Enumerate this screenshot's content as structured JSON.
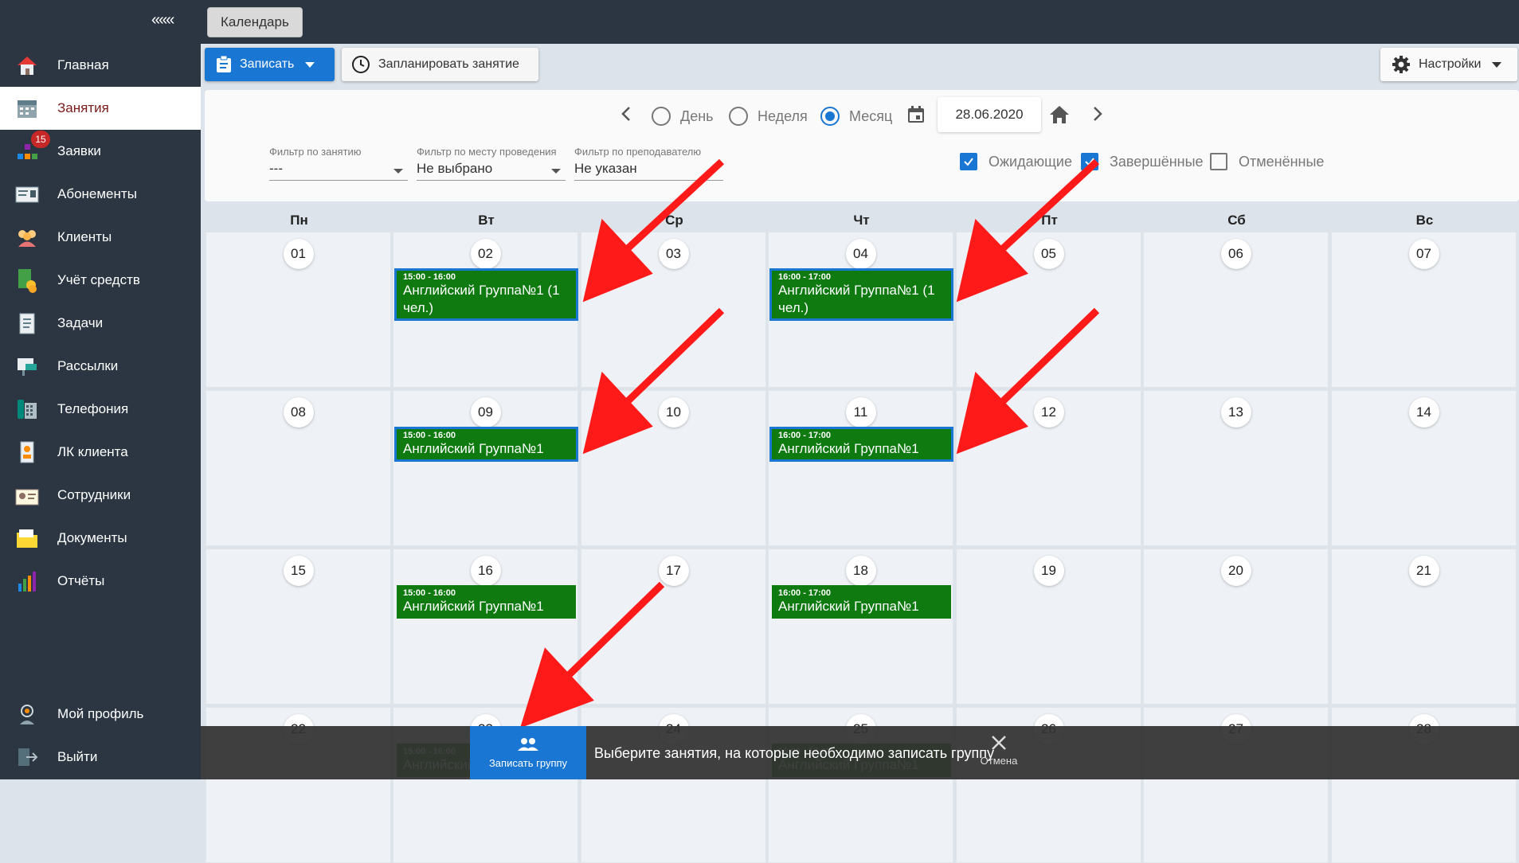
{
  "sidebar": {
    "collapse_label": "«««",
    "items": [
      {
        "label": "Главная",
        "icon": "home-icon"
      },
      {
        "label": "Занятия",
        "icon": "calendar-icon",
        "active": true
      },
      {
        "label": "Заявки",
        "icon": "orders-icon",
        "badge": "15"
      },
      {
        "label": "Абонементы",
        "icon": "subscription-card-icon"
      },
      {
        "label": "Клиенты",
        "icon": "clients-icon"
      },
      {
        "label": "Учёт средств",
        "icon": "money-icon"
      },
      {
        "label": "Задачи",
        "icon": "tasks-icon"
      },
      {
        "label": "Рассылки",
        "icon": "mailing-icon"
      },
      {
        "label": "Телефония",
        "icon": "phone-icon"
      },
      {
        "label": "ЛК клиента",
        "icon": "client-cabinet-icon"
      },
      {
        "label": "Сотрудники",
        "icon": "employees-icon"
      },
      {
        "label": "Документы",
        "icon": "documents-icon"
      },
      {
        "label": "Отчёты",
        "icon": "reports-icon"
      }
    ],
    "bottom": [
      {
        "label": "Мой профиль",
        "icon": "profile-icon"
      },
      {
        "label": "Выйти",
        "icon": "logout-icon"
      }
    ]
  },
  "topbar": {
    "tab_label": "Календарь"
  },
  "toolbar": {
    "enroll_label": "Записать",
    "plan_label": "Запланировать занятие",
    "settings_label": "Настройки"
  },
  "view": {
    "day_label": "День",
    "week_label": "Неделя",
    "month_label": "Месяц",
    "selected": "month",
    "date_value": "28.06.2020"
  },
  "filters": {
    "lesson": {
      "label": "Фильтр по занятию",
      "value": "---"
    },
    "place": {
      "label": "Фильтр по месту проведения",
      "value": "Не выбрано"
    },
    "teacher": {
      "label": "Фильтр по преподавателю",
      "value": "Не указан"
    }
  },
  "status_checks": {
    "pending": {
      "label": "Ожидающие",
      "checked": true
    },
    "done": {
      "label": "Завершённые",
      "checked": true
    },
    "cancelled": {
      "label": "Отменённые",
      "checked": false
    }
  },
  "calendar": {
    "weekdays": [
      "Пн",
      "Вт",
      "Ср",
      "Чт",
      "Пт",
      "Сб",
      "Вс"
    ],
    "weeks": [
      [
        "01",
        "02",
        "03",
        "04",
        "05",
        "06",
        "07"
      ],
      [
        "08",
        "09",
        "10",
        "11",
        "12",
        "13",
        "14"
      ],
      [
        "15",
        "16",
        "17",
        "18",
        "19",
        "20",
        "21"
      ],
      [
        "22",
        "23",
        "24",
        "25",
        "26",
        "27",
        "28"
      ]
    ],
    "events": {
      "w0_d1": {
        "time": "15:00 - 16:00",
        "title": "Английский Группа№1 (1 чел.)",
        "selected": true
      },
      "w0_d3": {
        "time": "16:00 - 17:00",
        "title": "Английский Группа№1 (1 чел.)",
        "selected": true
      },
      "w1_d1": {
        "time": "15:00 - 16:00",
        "title": "Английский Группа№1",
        "selected": true
      },
      "w1_d3": {
        "time": "16:00 - 17:00",
        "title": "Английский Группа№1",
        "selected": true
      },
      "w2_d1": {
        "time": "15:00 - 16:00",
        "title": "Английский Группа№1",
        "selected": false
      },
      "w2_d3": {
        "time": "16:00 - 17:00",
        "title": "Английский Группа№1",
        "selected": false
      },
      "w3_d1": {
        "time": "15:00 - 16:00",
        "title": "Английский",
        "selected": false
      },
      "w3_d3": {
        "time": "16:00 - 17:00",
        "title": "Английский Группа№1",
        "selected": false
      }
    }
  },
  "snackbar": {
    "action_label": "Записать группу",
    "message": "Выберите занятия, на которые необходимо записать группу",
    "cancel_label": "Отмена"
  },
  "colors": {
    "sidebar_bg": "#2b3642",
    "primary": "#1976d2",
    "event_green": "#0f7a10",
    "arrow_red": "#ff1a1a",
    "active_text": "#7a1b1b"
  }
}
